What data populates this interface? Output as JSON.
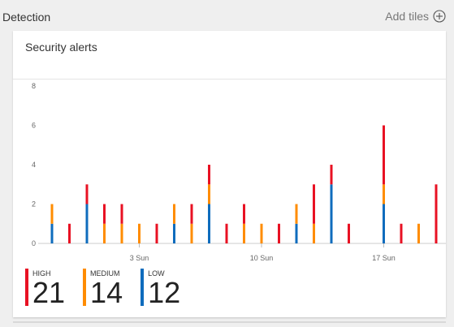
{
  "section": {
    "title": "Detection",
    "add_tiles_label": "Add tiles"
  },
  "card": {
    "title": "Security alerts"
  },
  "colors": {
    "high": "#e81123",
    "medium": "#ff8c00",
    "low": "#0f6cbd"
  },
  "chart_data": {
    "type": "bar",
    "stacked": true,
    "ylim": [
      0,
      8
    ],
    "y_ticks": [
      "0",
      "2",
      "4",
      "6",
      "8"
    ],
    "x_tick_labels": [
      {
        "label": "3 Sun",
        "index": 5
      },
      {
        "label": "10 Sun",
        "index": 12
      },
      {
        "label": "17 Sun",
        "index": 19
      }
    ],
    "categories": [
      "d1",
      "d2",
      "d3",
      "d4",
      "d5",
      "d6",
      "d7",
      "d8",
      "d9",
      "d10",
      "d11",
      "d12",
      "d13",
      "d14",
      "d15",
      "d16",
      "d17",
      "d18",
      "d19",
      "d20",
      "d21",
      "d22",
      "d23"
    ],
    "series": [
      {
        "name": "HIGH",
        "color_key": "high",
        "values": [
          0,
          1,
          1,
          1,
          1,
          0,
          1,
          0,
          1,
          1,
          1,
          1,
          0,
          1,
          0,
          2,
          1,
          1,
          0,
          3,
          1,
          0,
          3
        ]
      },
      {
        "name": "MEDIUM",
        "color_key": "medium",
        "values": [
          1,
          0,
          0,
          1,
          1,
          1,
          0,
          1,
          1,
          1,
          0,
          1,
          1,
          0,
          1,
          1,
          0,
          0,
          0,
          1,
          0,
          1,
          0
        ]
      },
      {
        "name": "LOW",
        "color_key": "low",
        "values": [
          1,
          0,
          2,
          0,
          0,
          0,
          0,
          1,
          0,
          2,
          0,
          0,
          0,
          0,
          1,
          0,
          3,
          0,
          0,
          2,
          0,
          0,
          0
        ]
      }
    ]
  },
  "legend": [
    {
      "label": "HIGH",
      "value": "21",
      "color_key": "high"
    },
    {
      "label": "MEDIUM",
      "value": "14",
      "color_key": "medium"
    },
    {
      "label": "LOW",
      "value": "12",
      "color_key": "low"
    }
  ]
}
